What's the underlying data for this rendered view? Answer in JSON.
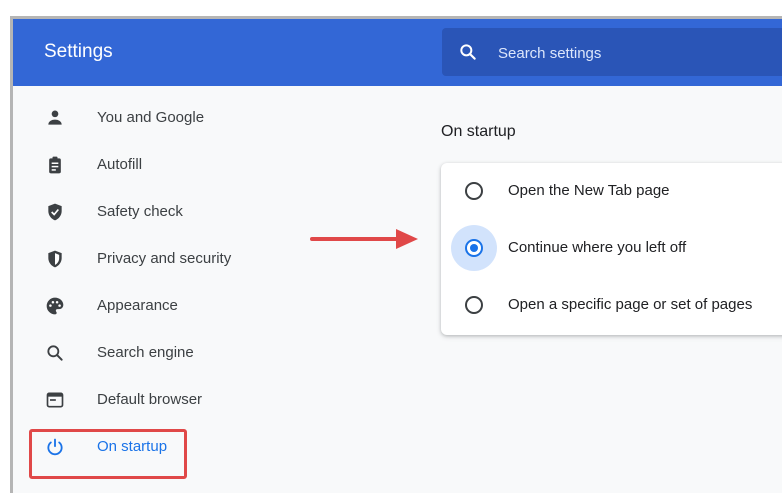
{
  "header": {
    "title": "Settings",
    "search_placeholder": "Search settings"
  },
  "sidebar": {
    "items": [
      {
        "label": "You and Google",
        "icon": "person-icon"
      },
      {
        "label": "Autofill",
        "icon": "clipboard-icon"
      },
      {
        "label": "Safety check",
        "icon": "shield-check-icon"
      },
      {
        "label": "Privacy and security",
        "icon": "shield-half-icon"
      },
      {
        "label": "Appearance",
        "icon": "palette-icon"
      },
      {
        "label": "Search engine",
        "icon": "search-icon"
      },
      {
        "label": "Default browser",
        "icon": "browser-window-icon"
      },
      {
        "label": "On startup",
        "icon": "power-icon",
        "active": true
      }
    ]
  },
  "main": {
    "section_title": "On startup",
    "options": [
      {
        "label": "Open the New Tab page",
        "checked": false
      },
      {
        "label": "Continue where you left off",
        "checked": true
      },
      {
        "label": "Open a specific page or set of pages",
        "checked": false
      }
    ]
  },
  "colors": {
    "header_bg": "#3367d6",
    "accent": "#1a73e8",
    "annotation": "#e04848"
  }
}
